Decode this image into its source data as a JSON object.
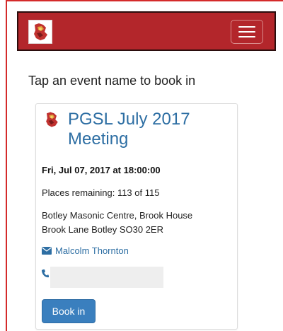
{
  "header": {
    "logo_icon": "crest-logo-icon",
    "menu_icon": "hamburger-menu-icon",
    "bar_color": "#b3262b"
  },
  "intro_text": "Tap an event name to book in",
  "event": {
    "icon": "crest-logo-icon",
    "title": "PGSL July 2017 Meeting",
    "datetime": "Fri, Jul 07, 2017 at 18:00:00",
    "places_remaining": "Places remaining: 113 of 115",
    "address_line1": "Botley Masonic Centre, Brook House",
    "address_line2": "Brook Lane Botley SO30 2ER",
    "contact_name": "Malcolm Thornton",
    "contact_icon": "envelope-icon",
    "phone_icon": "phone-icon",
    "phone_value": "",
    "book_label": "Book in",
    "link_color": "#2d6ea3",
    "button_color": "#3a7fbe"
  }
}
